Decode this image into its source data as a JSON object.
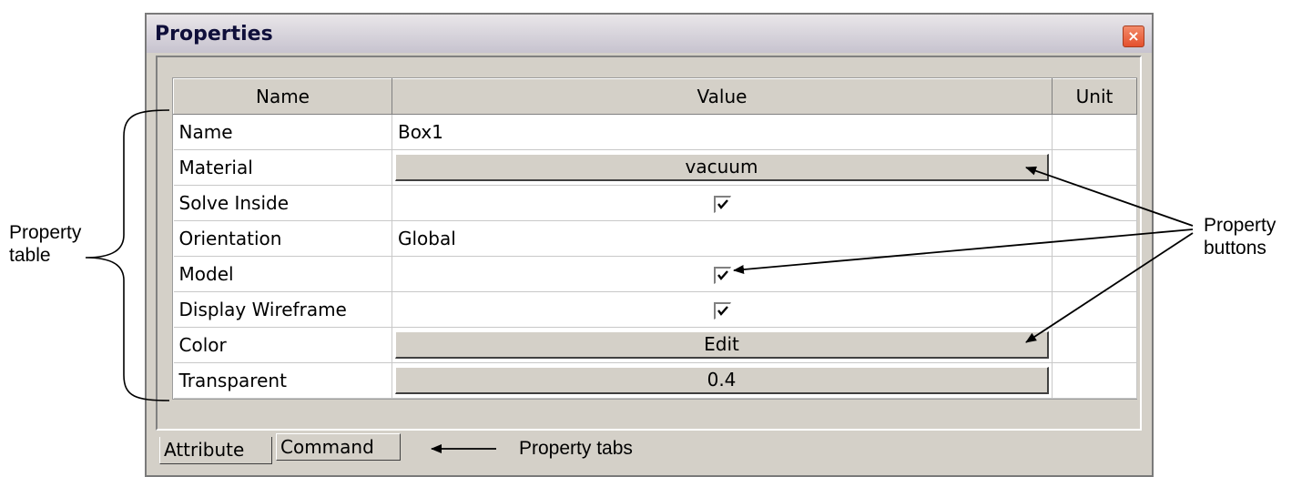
{
  "window": {
    "title": "Properties",
    "close_label": "×"
  },
  "table": {
    "headers": {
      "name": "Name",
      "value": "Value",
      "unit": "Unit"
    },
    "rows": [
      {
        "name": "Name",
        "value": "Box1",
        "kind": "text"
      },
      {
        "name": "Material",
        "value": "vacuum",
        "kind": "button"
      },
      {
        "name": "Solve Inside",
        "value": "",
        "kind": "checkbox",
        "checked": true
      },
      {
        "name": "Orientation",
        "value": "Global",
        "kind": "text"
      },
      {
        "name": "Model",
        "value": "",
        "kind": "checkbox",
        "checked": true
      },
      {
        "name": "Display Wireframe",
        "value": "",
        "kind": "checkbox",
        "checked": true
      },
      {
        "name": "Color",
        "value": "Edit",
        "kind": "button"
      },
      {
        "name": "Transparent",
        "value": "0.4",
        "kind": "button"
      }
    ]
  },
  "tabs": {
    "attribute": "Attribute",
    "command": "Command"
  },
  "annotations": {
    "property_table": [
      "Property",
      "table"
    ],
    "property_buttons": [
      "Property",
      "buttons"
    ],
    "property_tabs": "Property tabs"
  }
}
